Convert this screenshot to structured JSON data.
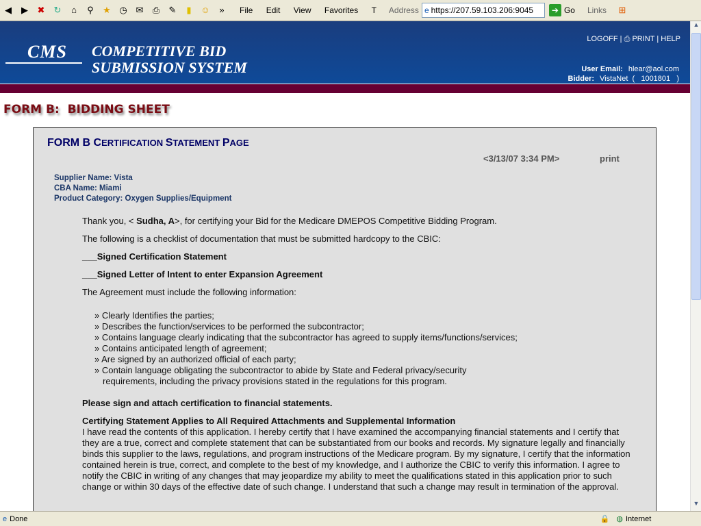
{
  "browser": {
    "menu": [
      "File",
      "Edit",
      "View",
      "Favorites",
      "T"
    ],
    "address_label": "Address",
    "url": "https://207.59.103.206:9045",
    "go": "Go",
    "links": "Links"
  },
  "header": {
    "logo": "CMS",
    "title_line1": "COMPETITIVE BID",
    "title_line2": "SUBMISSION SYSTEM",
    "logoff": "LOGOFF",
    "print": "PRINT",
    "help": "HELP",
    "user_email_label": "User Email:",
    "user_email": "hlear@aol.com",
    "bidder_label": "Bidder:",
    "bidder": "VistaNet  (   1001801   )"
  },
  "page_heading": "FORM B:  BIDDING SHEET",
  "panel": {
    "title_parts": [
      "FORM B ",
      "C",
      "ERTIFICATION ",
      "S",
      "TATEMENT ",
      "P",
      "AGE"
    ],
    "datetime": "<3/13/07 3:34 PM>",
    "print": "print",
    "supplier": "Supplier Name: Vista",
    "cba": "CBA Name: Miami",
    "category": "Product Category: Oxygen Supplies/Equipment",
    "thanks_pre": "Thank you, < ",
    "thanks_name": "Sudha, A",
    "thanks_post": ">, for certifying your Bid for the Medicare DMEPOS Competitive Bidding Program.",
    "checklist_intro": "The following is a checklist of documentation that must be submitted hardcopy to the CBIC:",
    "item1": "___Signed Certification Statement",
    "item2": "___Signed Letter of Intent to enter Expansion Agreement",
    "agreement_intro": "The Agreement must include the following information:",
    "bullets": [
      "» Clearly Identifies the parties;",
      "» Describes the function/services to be performed the subcontractor;",
      "» Contains language clearly indicating that the subcontractor has agreed to supply items/functions/services;",
      "» Contains anticipated length of agreement;",
      "» Are signed by an authorized official of each party;",
      "» Contain language obligating the subcontractor to abide by State and Federal privacy/security requirements, including the privacy provisions stated in the regulations for this program."
    ],
    "sign_note": "Please sign and attach certification to financial statements.",
    "cert_heading": "Certifying Statement Applies to All Required Attachments and Supplemental Information",
    "cert_text": "I have read the contents of this application. I hereby certify that I have examined the accompanying financial statements and I certify that they are a true, correct and complete statement that can be substantiated from our books and records. My signature legally and financially binds this supplier to the laws, regulations, and program instructions of the Medicare program. By my signature, I certify that the information contained herein is true, correct, and complete to the best of my knowledge, and I authorize the CBIC to verify this information. I agree to notify the CBIC in writing of any changes that may jeopardize my ability to meet the qualifications stated in this application prior to such change or within 30 days of the effective date of such change. I understand that such a change may result in termination of the approval."
  },
  "status": {
    "text": "Done",
    "zone": "Internet"
  }
}
